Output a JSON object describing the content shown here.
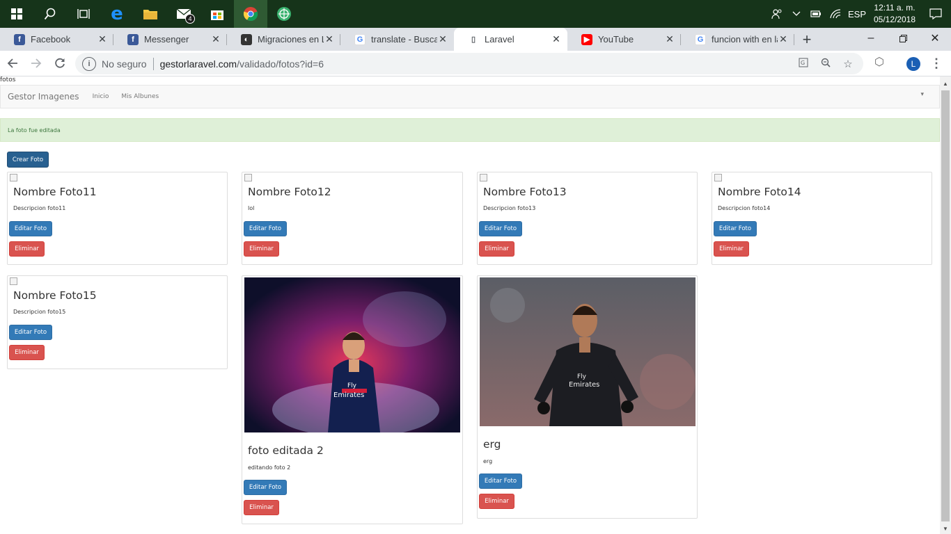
{
  "taskbar": {
    "icons": [
      "windows-start-icon",
      "search-icon",
      "task-view-icon",
      "edge-icon",
      "file-explorer-icon",
      "mail-icon",
      "store-icon",
      "chrome-icon",
      "app-icon"
    ],
    "mail_badge": "4",
    "lang": "ESP",
    "time": "12:11 a. m.",
    "date": "05/12/2018"
  },
  "tabs": [
    {
      "title": "Facebook",
      "icon": "facebook-icon",
      "color": "#3b5998",
      "glyph": "f"
    },
    {
      "title": "Messenger",
      "icon": "facebook-icon",
      "color": "#3b5998",
      "glyph": "f"
    },
    {
      "title": "Migraciones en La",
      "icon": "laravel-doc-icon",
      "color": "#333333",
      "glyph": "◐"
    },
    {
      "title": "translate - Buscar c",
      "icon": "google-icon",
      "color": "#ffffff",
      "glyph": "G"
    },
    {
      "title": "Laravel",
      "icon": "page-icon",
      "color": "#ffffff",
      "glyph": "▯",
      "active": true
    },
    {
      "title": "YouTube",
      "icon": "youtube-icon",
      "color": "#ff0000",
      "glyph": "▶"
    },
    {
      "title": "funcion with en lar",
      "icon": "google-icon",
      "color": "#ffffff",
      "glyph": "G"
    }
  ],
  "address": {
    "security": "No seguro",
    "host": "gestorlaravel.com",
    "path": "/validado/fotos?id=6"
  },
  "profile_initial": "L",
  "page": {
    "label": "fotos",
    "brand": "Gestor Imagenes",
    "nav": [
      "Inicio",
      "Mis Albunes"
    ],
    "alert": "La foto fue editada",
    "create_button": "Crear Foto",
    "edit_label": "Editar Foto",
    "delete_label": "Eliminar",
    "photos": [
      {
        "title": "Nombre Foto11",
        "desc": "Descripcion foto11",
        "image": "broken"
      },
      {
        "title": "Nombre Foto12",
        "desc": "lol",
        "image": "broken"
      },
      {
        "title": "Nombre Foto13",
        "desc": "Descripcion foto13",
        "image": "broken"
      },
      {
        "title": "Nombre Foto14",
        "desc": "Descripcion foto14",
        "image": "broken"
      },
      {
        "title": "Nombre Foto15",
        "desc": "Descripcion foto15",
        "image": "broken"
      },
      {
        "title": "foto editada 2",
        "desc": "editando foto 2",
        "image": "player-nebula-photo"
      },
      {
        "title": "erg",
        "desc": "erg",
        "image": "player-stadium-photo"
      }
    ]
  }
}
